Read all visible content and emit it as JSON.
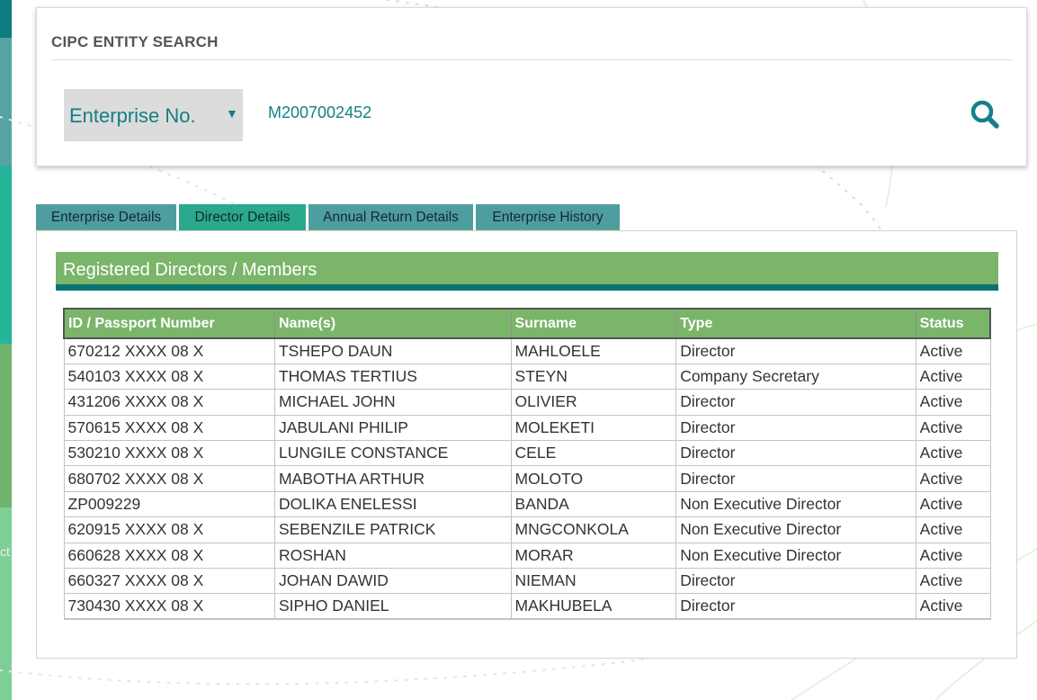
{
  "sidebar": {
    "strip_colors": [
      "#0e7d80",
      "#55a3a3",
      "#27b59a",
      "#6fb46f",
      "#7ecf97"
    ],
    "partial_text": "ct"
  },
  "search": {
    "title": "CIPC ENTITY SEARCH",
    "search_type": "Enterprise No.",
    "dropdown_arrow": "▼",
    "query_value": "M2007002452",
    "search_icon": "search-icon"
  },
  "tabs": [
    {
      "label": "Enterprise Details",
      "active": false
    },
    {
      "label": "Director Details",
      "active": true
    },
    {
      "label": "Annual Return Details",
      "active": false
    },
    {
      "label": "Enterprise History",
      "active": false
    }
  ],
  "directors_section": {
    "title": "Registered Directors / Members",
    "columns": [
      "ID / Passport Number",
      "Name(s)",
      "Surname",
      "Type",
      "Status"
    ],
    "rows": [
      [
        "670212 XXXX 08 X",
        "TSHEPO DAUN",
        "MAHLOELE",
        "Director",
        "Active"
      ],
      [
        "540103 XXXX 08 X",
        "THOMAS TERTIUS",
        "STEYN",
        "Company Secretary",
        "Active"
      ],
      [
        "431206 XXXX 08 X",
        "MICHAEL JOHN",
        "OLIVIER",
        "Director",
        "Active"
      ],
      [
        "570615 XXXX 08 X",
        "JABULANI PHILIP",
        "MOLEKETI",
        "Director",
        "Active"
      ],
      [
        "530210 XXXX 08 X",
        "LUNGILE CONSTANCE",
        "CELE",
        "Director",
        "Active"
      ],
      [
        "680702 XXXX 08 X",
        "MABOTHA ARTHUR",
        "MOLOTO",
        "Director",
        "Active"
      ],
      [
        "ZP009229",
        "DOLIKA ENELESSI",
        "BANDA",
        "Non Executive Director",
        "Active"
      ],
      [
        "620915 XXXX 08 X",
        "SEBENZILE PATRICK",
        "MNGCONKOLA",
        "Non Executive Director",
        "Active"
      ],
      [
        "660628 XXXX 08 X",
        "ROSHAN",
        "MORAR",
        "Non Executive Director",
        "Active"
      ],
      [
        "660327 XXXX 08 X",
        "JOHAN DAWID",
        "NIEMAN",
        "Director",
        "Active"
      ],
      [
        "730430 XXXX 08 X",
        "SIPHO DANIEL",
        "MAKHUBELA",
        "Director",
        "Active"
      ]
    ]
  },
  "colors": {
    "teal_accent": "#15808a",
    "green_header": "#7ab56a",
    "dark_teal_rule": "#0b7372",
    "tab_bg": "#4e9ea0",
    "tab_active_bg": "#2aa98c"
  }
}
